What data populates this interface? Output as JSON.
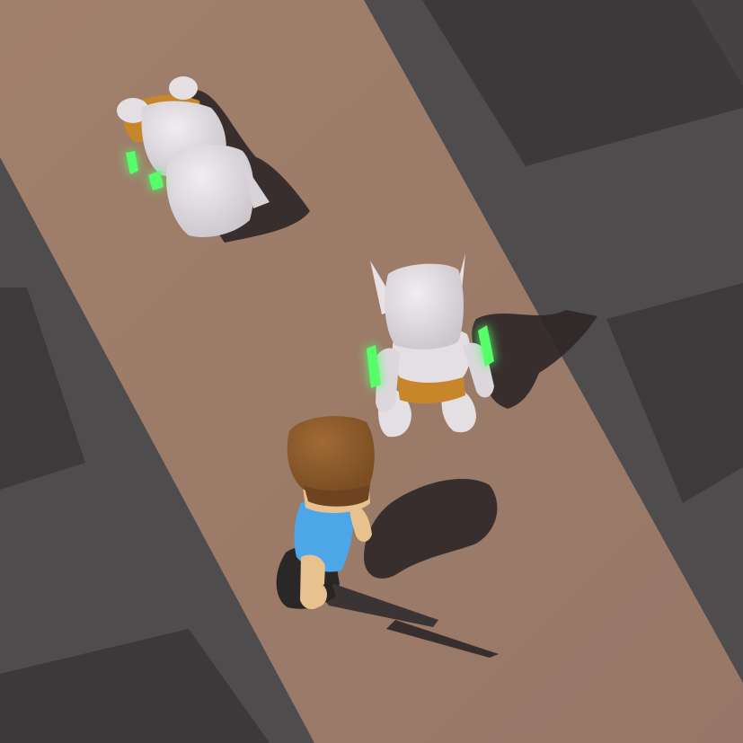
{
  "scene": {
    "colors": {
      "ground": "#4f4c4d",
      "tile_dark": "#3f3c3e",
      "tile_light": "#59565a",
      "path": "#9a7a66",
      "shadow": "#2d2627",
      "skin": "#e7c28f",
      "hair": "#8b5a2b",
      "shirt": "#4da6e8",
      "pants": "#2a2727",
      "sword": "#3a3434",
      "enemy_body": "#e3dfe2",
      "enemy_shade": "#bdb7bd",
      "enemy_shorts": "#c8862b",
      "glow": "#57ff6a"
    },
    "entities": [
      {
        "name": "player-character",
        "kind": "hero"
      },
      {
        "name": "enemy-standing",
        "kind": "goblin",
        "state": "alive"
      },
      {
        "name": "enemy-defeated",
        "kind": "goblin",
        "state": "knocked-down"
      }
    ]
  }
}
